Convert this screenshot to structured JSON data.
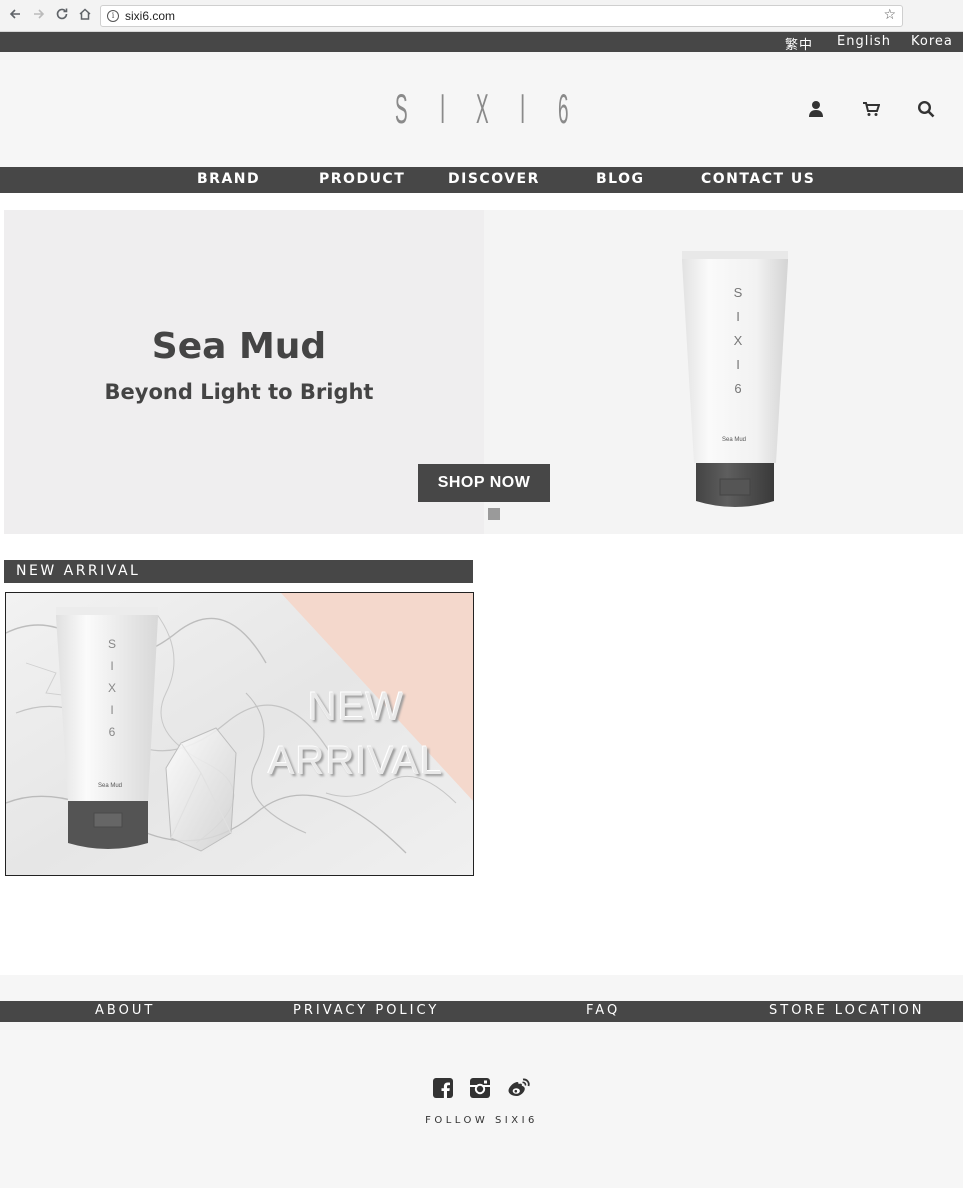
{
  "browser": {
    "url": "sixi6.com",
    "icons": [
      "back-icon",
      "forward-icon",
      "reload-icon",
      "home-icon",
      "info-icon",
      "star-icon"
    ]
  },
  "language_bar": {
    "items": [
      "繁中",
      "English",
      "Korea"
    ]
  },
  "header": {
    "logo_text": "SIXI6",
    "logo_letters": [
      "S",
      "I",
      "X",
      "I",
      "6"
    ],
    "icons": [
      "user-icon",
      "cart-icon",
      "search-icon"
    ]
  },
  "main_nav": {
    "items": [
      "BRAND",
      "PRODUCT",
      "DISCOVER",
      "BLOG",
      "CONTACT US"
    ]
  },
  "hero": {
    "title": "Sea Mud",
    "subtitle": "Beyond Light to Bright",
    "button_label": "SHOP NOW",
    "product_brand": "SIXI6",
    "product_name": "Sea Mud"
  },
  "new_arrival": {
    "section_label": "NEW ARRIVAL",
    "image_text_line1": "NEW",
    "image_text_line2": "ARRIVAL",
    "product_brand": "SIXI6",
    "product_name": "Sea Mud"
  },
  "footer": {
    "nav_items": [
      "ABOUT",
      "PRIVACY POLICY",
      "FAQ",
      "STORE LOCATION"
    ],
    "social_icons": [
      "facebook-icon",
      "instagram-icon",
      "weibo-icon"
    ],
    "follow_text": "FOLLOW SIXI6"
  },
  "colors": {
    "bar_dark": "#474747",
    "header_bg": "#f6f6f6",
    "hero_left_bg": "#efeeef",
    "peach": "#f4d8cc"
  }
}
